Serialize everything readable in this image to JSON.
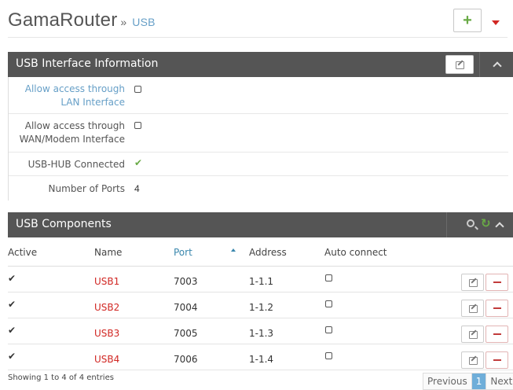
{
  "header": {
    "title": "GamaRouter",
    "separator": "»",
    "breadcrumb": "USB",
    "add_label": "+"
  },
  "info_panel": {
    "title": "USB Interface Information",
    "rows": [
      {
        "label_line1": "Allow access through",
        "label_line2": "LAN Interface",
        "value_type": "checkbox",
        "checked": false
      },
      {
        "label_line1": "Allow access through",
        "label_line2": "WAN/Modem Interface",
        "value_type": "checkbox",
        "checked": false
      },
      {
        "label": "USB-HUB Connected",
        "value_type": "check",
        "checked": true
      },
      {
        "label": "Number of Ports",
        "value": "4"
      }
    ]
  },
  "components_panel": {
    "title": "USB Components",
    "columns": [
      "Active",
      "Name",
      "Port",
      "Address",
      "Auto connect"
    ],
    "sorted_column": "Port",
    "rows": [
      {
        "active": true,
        "name": "USB1",
        "port": "7003",
        "address": "1-1.1",
        "auto_connect": false
      },
      {
        "active": true,
        "name": "USB2",
        "port": "7004",
        "address": "1-1.2",
        "auto_connect": false
      },
      {
        "active": true,
        "name": "USB3",
        "port": "7005",
        "address": "1-1.3",
        "auto_connect": false
      },
      {
        "active": true,
        "name": "USB4",
        "port": "7006",
        "address": "1-1.4",
        "auto_connect": false
      }
    ],
    "footer_info": "Showing 1 to 4 of 4 entries",
    "pagination": {
      "previous": "Previous",
      "current": "1",
      "next": "Next"
    }
  },
  "icons": {
    "check": "✔",
    "refresh": "↻"
  },
  "colors": {
    "accent_blue": "#669fc7",
    "success_green": "#69aa46",
    "danger_red": "#d12723",
    "panel_header": "#555555"
  }
}
